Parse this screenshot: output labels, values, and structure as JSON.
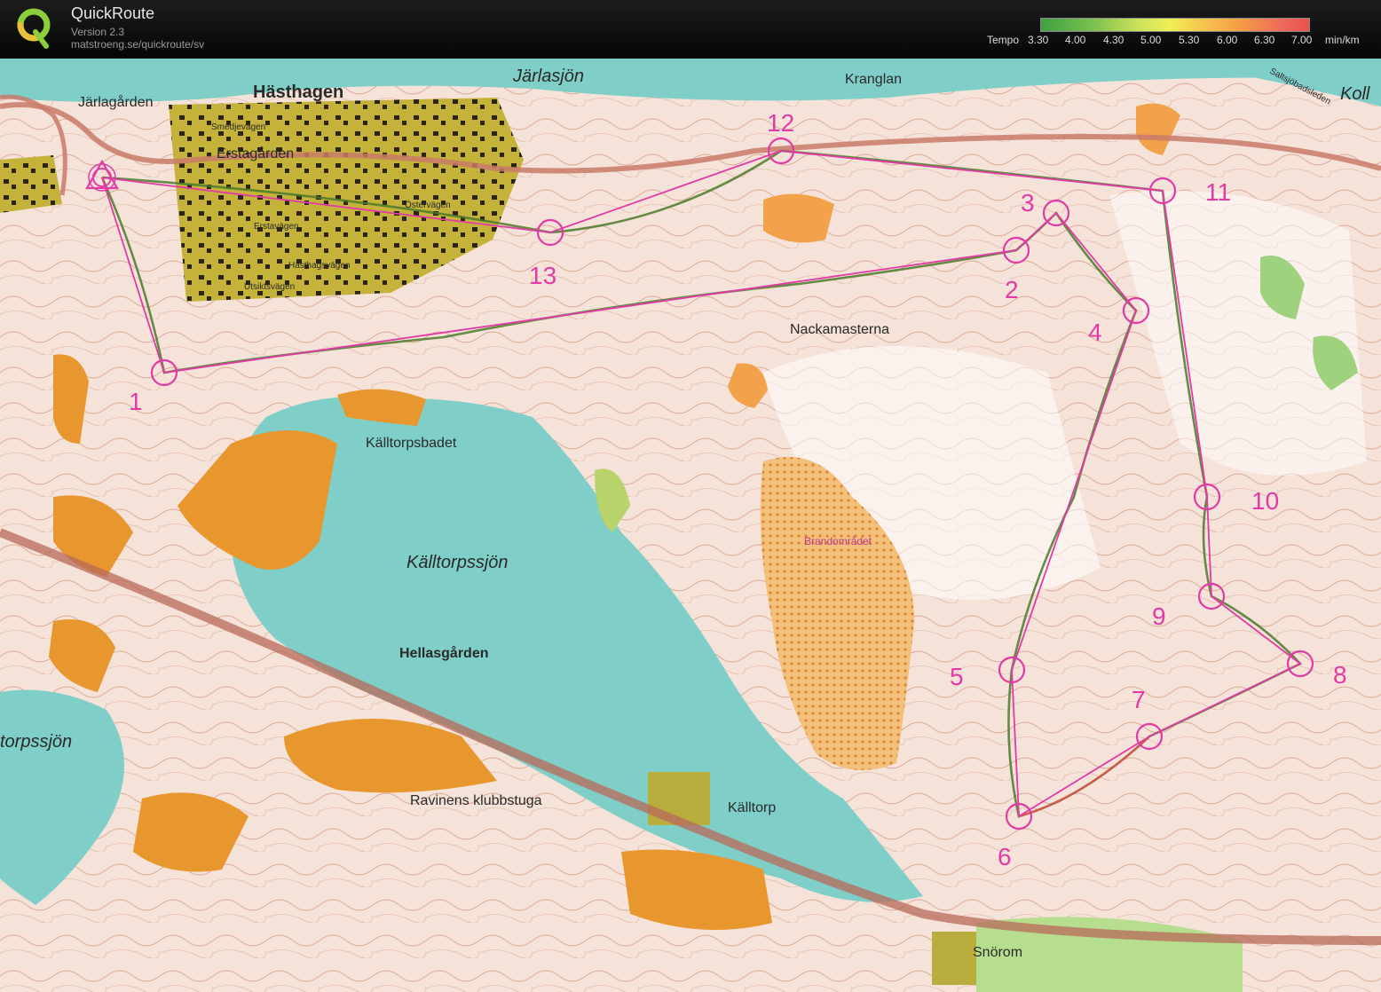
{
  "app": {
    "title": "QuickRoute",
    "version": "Version 2.3",
    "url": "matstroeng.se/quickroute/sv"
  },
  "legend": {
    "label": "Tempo",
    "ticks": [
      "3.30",
      "4.00",
      "4.30",
      "5.00",
      "5.30",
      "6.00",
      "6.30",
      "7.00"
    ],
    "unit": "min/km",
    "gradient_colors": [
      "#3fa044",
      "#7cc24f",
      "#c8df5a",
      "#f0ef56",
      "#f5c64e",
      "#f59a45",
      "#ee6a5c",
      "#e8504f"
    ]
  },
  "map": {
    "colors": {
      "water": "#7fcfc8",
      "open_land": "#e8962e",
      "urban": "#b9ad3e",
      "course": "#e23aa6",
      "route_green": "#4a7a2a",
      "contour": "#b5562f",
      "road": "#c97a6a"
    },
    "place_names": [
      "Hästhagen",
      "Järlasjön",
      "Kranglan",
      "Järlagården",
      "Erstagården",
      "Smedjevägen",
      "Erstavägen",
      "Östervägen",
      "Hästhagsvägen",
      "Utsiktsvägen",
      "Nackamasterna",
      "Källtorpsbadet",
      "Källtorpssjön",
      "Brandområdet",
      "Hellasgården",
      "Ravinens klubbstuga",
      "Källtorp",
      "Snörom",
      "torpssjön",
      "Saltsjöbadsleden",
      "Koll"
    ],
    "controls": [
      "1",
      "2",
      "3",
      "4",
      "5",
      "6",
      "7",
      "8",
      "9",
      "10",
      "11",
      "12",
      "13"
    ]
  }
}
